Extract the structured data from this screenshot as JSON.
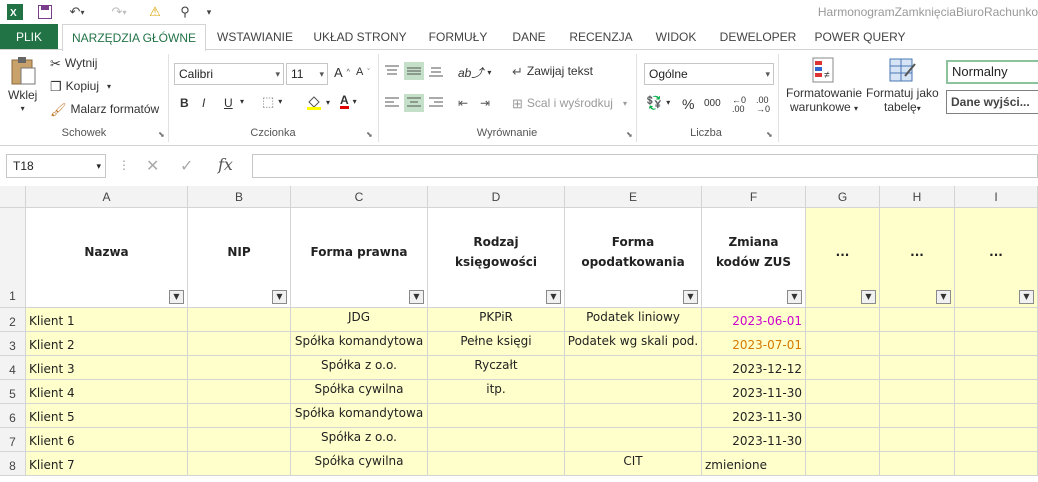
{
  "window": {
    "title": "HarmonogramZamknięciaBiuroRachunko"
  },
  "tabs": [
    "PLIK",
    "NARZĘDZIA GŁÓWNE",
    "WSTAWIANIE",
    "UKŁAD STRONY",
    "FORMUŁY",
    "DANE",
    "RECENZJA",
    "WIDOK",
    "DEWELOPER",
    "POWER QUERY"
  ],
  "clipboard": {
    "paste": "Wklej",
    "cut": "Wytnij",
    "copy": "Kopiuj",
    "painter": "Malarz formatów",
    "label": "Schowek"
  },
  "font": {
    "name": "Calibri",
    "size": "11",
    "bold": "B",
    "italic": "I",
    "underline": "U",
    "label": "Czcionka"
  },
  "alignment": {
    "wrap": "Zawijaj tekst",
    "merge": "Scal i wyśrodkuj",
    "label": "Wyrównanie"
  },
  "number": {
    "format": "Ogólne",
    "percent": "%",
    "thousands": "000",
    "label": "Liczba"
  },
  "styles": {
    "conditional_1": "Formatowanie",
    "conditional_2": "warunkowe",
    "table_1": "Formatuj jako",
    "table_2": "tabelę",
    "normal": "Normalny",
    "output": "Dane wyjści..."
  },
  "formula_bar": {
    "cell_ref": "T18",
    "fx": "fx",
    "value": ""
  },
  "columns": [
    "A",
    "B",
    "C",
    "D",
    "E",
    "F",
    "G",
    "H",
    "I"
  ],
  "header_row": {
    "row": "1",
    "cells": [
      "Nazwa",
      "NIP",
      "Forma prawna",
      "Rodzaj księgowości",
      "Forma opodatkowania",
      "Zmiana kodów ZUS",
      "...",
      "...",
      "..."
    ]
  },
  "rows": [
    {
      "row": "2",
      "cells": [
        "Klient 1",
        "",
        "JDG",
        "PKPiR",
        "Podatek liniowy",
        "2023-06-01",
        "",
        "",
        ""
      ]
    },
    {
      "row": "3",
      "cells": [
        "Klient 2",
        "",
        "Spółka komandytowa",
        "Pełne księgi",
        "Podatek wg skali pod.",
        "2023-07-01",
        "",
        "",
        ""
      ]
    },
    {
      "row": "4",
      "cells": [
        "Klient 3",
        "",
        "Spółka z o.o.",
        "Ryczałt",
        "",
        "2023-12-12",
        "",
        "",
        ""
      ]
    },
    {
      "row": "5",
      "cells": [
        "Klient 4",
        "",
        "Spółka cywilna",
        "itp.",
        "",
        "2023-11-30",
        "",
        "",
        ""
      ]
    },
    {
      "row": "6",
      "cells": [
        "Klient 5",
        "",
        "Spółka komandytowa",
        "",
        "",
        "2023-11-30",
        "",
        "",
        ""
      ]
    },
    {
      "row": "7",
      "cells": [
        "Klient 6",
        "",
        "Spółka z o.o.",
        "",
        "",
        "2023-11-30",
        "",
        "",
        ""
      ]
    },
    {
      "row": "8",
      "cells": [
        "Klient 7",
        "",
        "Spółka cywilna",
        "",
        "CIT",
        "zmienione",
        "",
        "",
        ""
      ]
    }
  ],
  "colors": {
    "accent": "#217346",
    "cell_fill": "#ffffcc",
    "date_purple": "#cc00cc",
    "date_orange": "#d47a00",
    "grid": "#d4d4d4"
  }
}
